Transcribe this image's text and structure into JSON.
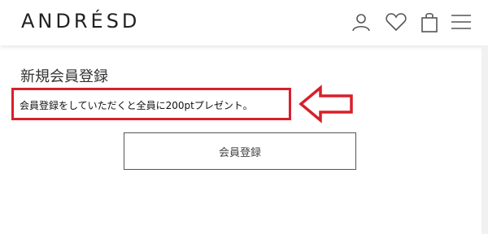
{
  "header": {
    "logo": "ANDRÉSD",
    "icons": [
      "user-icon",
      "heart-icon",
      "bag-icon",
      "menu-icon"
    ]
  },
  "main": {
    "page_title": "新規会員登録",
    "promo_text": "会員登録をしていただくと全員に200ptプレゼント。",
    "register_button_label": "会員登録"
  },
  "colors": {
    "annotation_red": "#d7202b",
    "text": "#222222",
    "icon_gray": "#555555"
  }
}
